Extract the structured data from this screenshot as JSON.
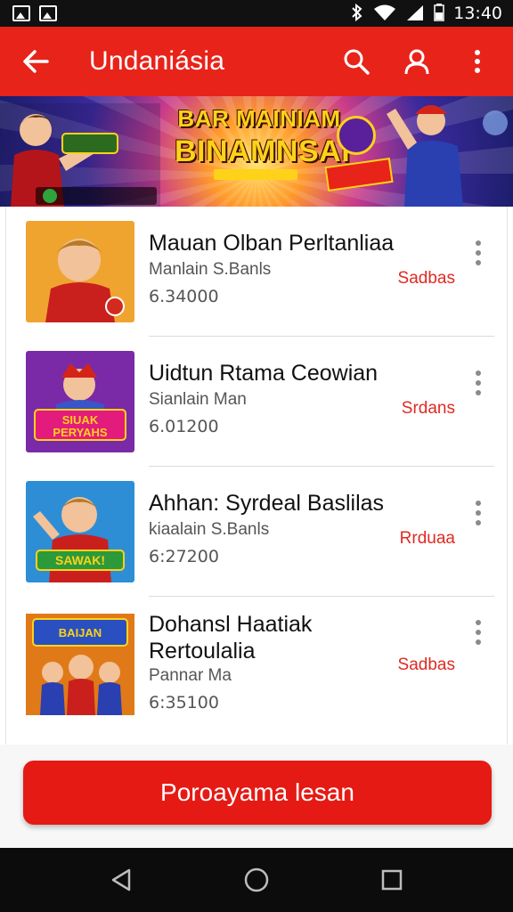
{
  "status_bar": {
    "time": "13:40",
    "icons": [
      "image-icon",
      "gallery-icon",
      "bluetooth-icon",
      "wifi-icon",
      "signal-icon",
      "battery-icon"
    ]
  },
  "app_bar": {
    "title": "Undaniásia",
    "icons": [
      "back-arrow-icon",
      "search-icon",
      "account-icon",
      "more-vert-icon"
    ]
  },
  "banner": {
    "line1": "BAR MAINIAM",
    "line2": "BINAMNSAI",
    "fab_icon": "share-icon"
  },
  "list": {
    "items": [
      {
        "title": "Mauan Olban Perltanliaa",
        "subtitle": "Manlain S.Banls",
        "price": "6.34000",
        "badge": "Sadbas"
      },
      {
        "title": "Uidtun Rtama Ceowian",
        "subtitle": "Sianlain Man",
        "price": "6.01200",
        "badge": "Srdans"
      },
      {
        "title": "Ahhan: Syrdeal Baslilas",
        "subtitle": "kiaalain S.Banls",
        "price": "6:27200",
        "badge": "Rrduaa"
      },
      {
        "title": "Dohansl Haatiak Rertoulalia",
        "subtitle": "Pannar Ma",
        "price": "6:35100",
        "badge": "Sadbas"
      }
    ]
  },
  "cta": {
    "label": "Poroayama lesan"
  },
  "nav_bar": {
    "icons": [
      "back-triangle-icon",
      "home-circle-icon",
      "recents-square-icon"
    ]
  },
  "colors": {
    "primary": "#e8231a",
    "cta": "#e51a14",
    "badge_text": "#e02a22"
  }
}
